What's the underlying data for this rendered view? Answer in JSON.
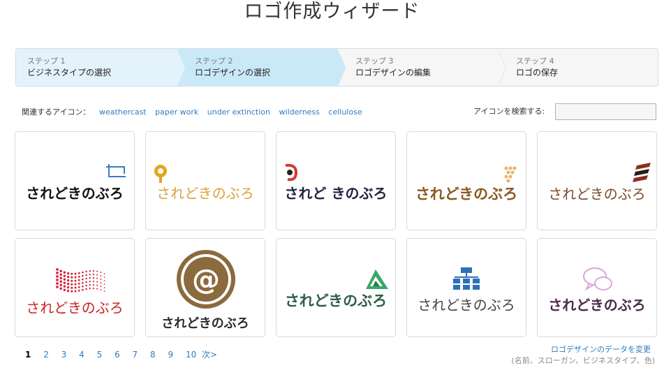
{
  "page": {
    "title": "ロゴ作成ウィザード"
  },
  "steps": [
    {
      "num": "ステップ 1",
      "label": "ビジネスタイプの選択"
    },
    {
      "num": "ステップ 2",
      "label": "ロゴデザインの選択"
    },
    {
      "num": "ステップ 3",
      "label": "ロゴデザインの編集"
    },
    {
      "num": "ステップ 4",
      "label": "ロゴの保存"
    }
  ],
  "related": {
    "label": "関連するアイコン：",
    "tags": [
      "weathercast",
      "paper work",
      "under extinction",
      "wilderness",
      "cellulose"
    ]
  },
  "search": {
    "label": "アイコンを検索する:",
    "value": ""
  },
  "logos": [
    {
      "text": "されどきのぶろ",
      "color": "#111111",
      "icon": "crop-frame-icon"
    },
    {
      "text": "されどきのぶろ",
      "color": "#d9a23a",
      "icon": "location-pin-icon"
    },
    {
      "text": "されど きのぶろ",
      "color": "#222244",
      "icon": "red-d-swirl-icon"
    },
    {
      "text": "されどきのぶろ",
      "color": "#8a5a1e",
      "icon": "dot-triangle-icon"
    },
    {
      "text": "されどきのぶろ",
      "color": "#7a4a2a",
      "icon": "stripes-icon"
    },
    {
      "text": "されどきのぶろ",
      "color": "#cc2222",
      "icon": "red-dot-wave-icon"
    },
    {
      "text": "されどきのぶろ",
      "color": "#2a2a2a",
      "icon": "at-sign-circle-icon"
    },
    {
      "text": "されどきのぶろ",
      "color": "#2e5e4a",
      "icon": "green-triangle-icon"
    },
    {
      "text": "されどきのぶろ",
      "color": "#444444",
      "icon": "org-chart-icon"
    },
    {
      "text": "されどきのぶろ",
      "color": "#4a2a4a",
      "icon": "speech-bubbles-icon"
    }
  ],
  "pager": {
    "pages": [
      "1",
      "2",
      "3",
      "4",
      "5",
      "6",
      "7",
      "8",
      "9",
      "10"
    ],
    "next": "次>",
    "current": "1"
  },
  "edit_link": "ロゴデザインのデータを変更",
  "edit_sub": "(名前、スローガン、ビジネスタイプ、色)"
}
